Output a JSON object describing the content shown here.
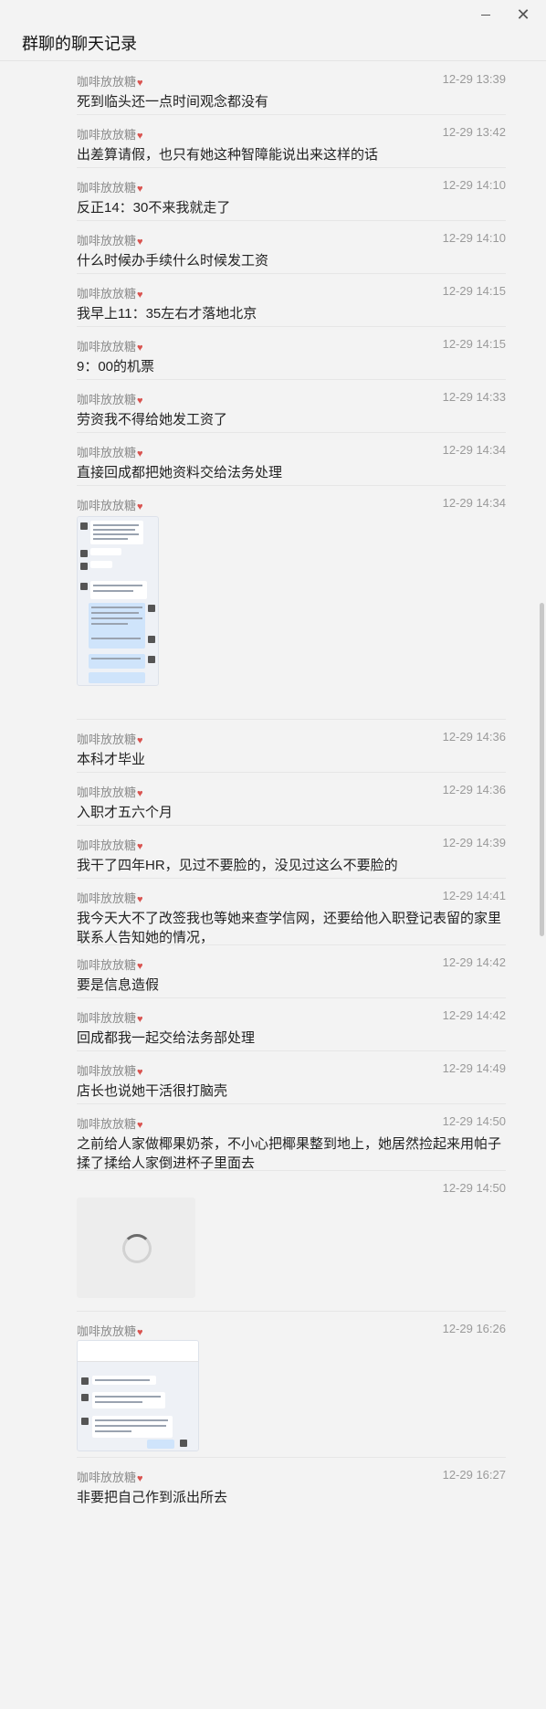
{
  "window": {
    "title": "群聊的聊天记录"
  },
  "messages": [
    {
      "sender": "咖啡放放糖",
      "time": "12-29 13:39",
      "text": "死到临头还一点时间观念都没有"
    },
    {
      "sender": "咖啡放放糖",
      "time": "12-29 13:42",
      "text": "出差算请假，也只有她这种智障能说出来这样的话"
    },
    {
      "sender": "咖啡放放糖",
      "time": "12-29 14:10",
      "text": "反正14：30不来我就走了"
    },
    {
      "sender": "咖啡放放糖",
      "time": "12-29 14:10",
      "text": "什么时候办手续什么时候发工资"
    },
    {
      "sender": "咖啡放放糖",
      "time": "12-29 14:15",
      "text": "我早上11：35左右才落地北京"
    },
    {
      "sender": "咖啡放放糖",
      "time": "12-29 14:15",
      "text": "9：00的机票"
    },
    {
      "sender": "咖啡放放糖",
      "time": "12-29 14:33",
      "text": "劳资我不得给她发工资了"
    },
    {
      "sender": "咖啡放放糖",
      "time": "12-29 14:34",
      "text": "直接回成都把她资料交给法务处理"
    },
    {
      "sender": "咖啡放放糖",
      "time": "12-29 14:34",
      "text": ""
    },
    {
      "sender": "咖啡放放糖",
      "time": "12-29 14:36",
      "text": "本科才毕业"
    },
    {
      "sender": "咖啡放放糖",
      "time": "12-29 14:36",
      "text": "入职才五六个月"
    },
    {
      "sender": "咖啡放放糖",
      "time": "12-29 14:39",
      "text": "我干了四年HR，见过不要脸的，没见过这么不要脸的"
    },
    {
      "sender": "咖啡放放糖",
      "time": "12-29 14:41",
      "text": "我今天大不了改签我也等她来查学信网，还要给他入职登记表留的家里联系人告知她的情况，"
    },
    {
      "sender": "咖啡放放糖",
      "time": "12-29 14:42",
      "text": "要是信息造假"
    },
    {
      "sender": "咖啡放放糖",
      "time": "12-29 14:42",
      "text": "回成都我一起交给法务部处理"
    },
    {
      "sender": "咖啡放放糖",
      "time": "12-29 14:49",
      "text": "店长也说她干活很打脑壳"
    },
    {
      "sender": "咖啡放放糖",
      "time": "12-29 14:50",
      "text": "之前给人家做椰果奶茶，不小心把椰果整到地上，她居然捡起来用帕子揉了揉给人家倒进杯子里面去"
    },
    {
      "sender": "",
      "time": "12-29 14:50",
      "text": ""
    },
    {
      "sender": "咖啡放放糖",
      "time": "12-29 16:26",
      "text": ""
    },
    {
      "sender": "咖啡放放糖",
      "time": "12-29 16:27",
      "text": "非要把自己作到派出所去"
    }
  ],
  "icons": {
    "close": "close-icon",
    "minimize": "minimize-icon",
    "sender_badge": "heart-icon"
  },
  "colors": {
    "background": "#f3f3f3",
    "sender_text": "#8a8a8a",
    "message_text": "#222222",
    "separator": "#e6e6e6",
    "badge": "#d9534f"
  }
}
